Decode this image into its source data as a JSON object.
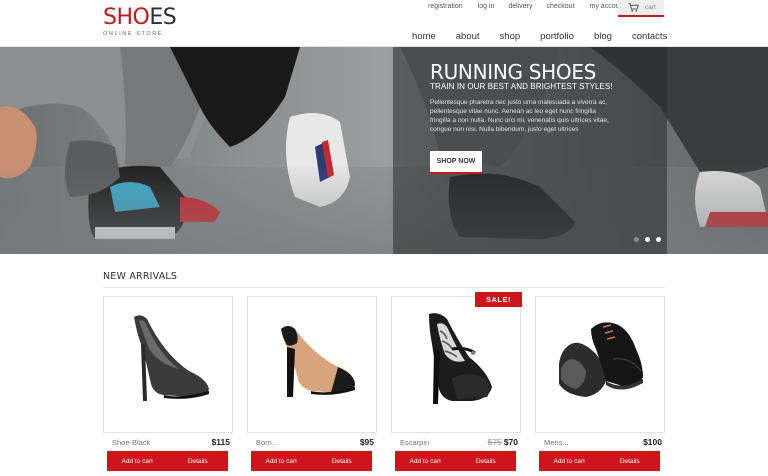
{
  "logo": {
    "main_red": "SHO",
    "main_dark": "ES",
    "sub": "ONLINE STORE"
  },
  "top_links": [
    "registration",
    "log in",
    "delivery",
    "checkout",
    "my account"
  ],
  "cart": {
    "label": "cart",
    "icon": "cart-icon"
  },
  "nav": {
    "items": [
      "home",
      "about",
      "shop",
      "portfolio",
      "blog",
      "contacts"
    ],
    "active": "home"
  },
  "hero": {
    "title": "RUNNING SHOES",
    "subtitle": "TRAIN IN OUR BEST AND BRIGHTEST STYLES!",
    "text": "Pellentesque pharetra nec justo urna malesuada a viverra ac, pellentesque vitae nunc. Aenean ac leo eget nunc fringilla fringilla a non nulla. Nunc orci mi, venenatis quis ultrices vitae, congue non nisi. Nulla bibendum, justo eget ultrices",
    "button": "SHOP NOW",
    "slides_total": 3,
    "slide_active": 2
  },
  "section": {
    "title": "NEW ARRIVALS"
  },
  "colors": {
    "accent": "#d0141b",
    "brand_red": "#c8161d"
  },
  "products": [
    {
      "name": "Shoe-Black",
      "price": "$115",
      "old_price": "",
      "badge": "",
      "add": "Add to cart",
      "details": "Details"
    },
    {
      "name": "Born...",
      "price": "$95",
      "old_price": "",
      "badge": "",
      "add": "Add to cart",
      "details": "Details"
    },
    {
      "name": "Escarpin",
      "price": "$70",
      "old_price": "$75",
      "badge": "SALE!",
      "add": "Add to cart",
      "details": "Details"
    },
    {
      "name": "Mens...",
      "price": "$100",
      "old_price": "",
      "badge": "",
      "add": "Add to cart",
      "details": "Details"
    }
  ]
}
